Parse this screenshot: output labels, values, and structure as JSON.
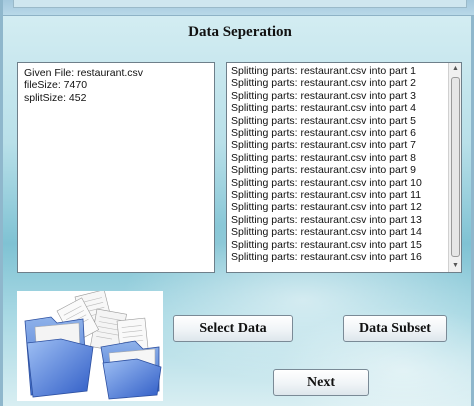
{
  "heading": "Data Seperation",
  "info_lines": [
    "Given File: restaurant.csv",
    "fileSize: 7470",
    "splitSize: 452"
  ],
  "log_lines": [
    "Splitting parts: restaurant.csv into part 1",
    "Splitting parts: restaurant.csv into part 2",
    "Splitting parts: restaurant.csv into part 3",
    "Splitting parts: restaurant.csv into part 4",
    "Splitting parts: restaurant.csv into part 5",
    "Splitting parts: restaurant.csv into part 6",
    "Splitting parts: restaurant.csv into part 7",
    "Splitting parts: restaurant.csv into part 8",
    "Splitting parts: restaurant.csv into part 9",
    "Splitting parts: restaurant.csv into part 10",
    "Splitting parts: restaurant.csv into part 11",
    "Splitting parts: restaurant.csv into part 12",
    "Splitting parts: restaurant.csv into part 13",
    "Splitting parts: restaurant.csv into part 14",
    "Splitting parts: restaurant.csv into part 15",
    "Splitting parts: restaurant.csv into part 16"
  ],
  "buttons": {
    "select_data": "Select Data",
    "data_subset": "Data Subset",
    "next": "Next"
  },
  "icons": {
    "illustration": "folder-with-documents-icon"
  }
}
